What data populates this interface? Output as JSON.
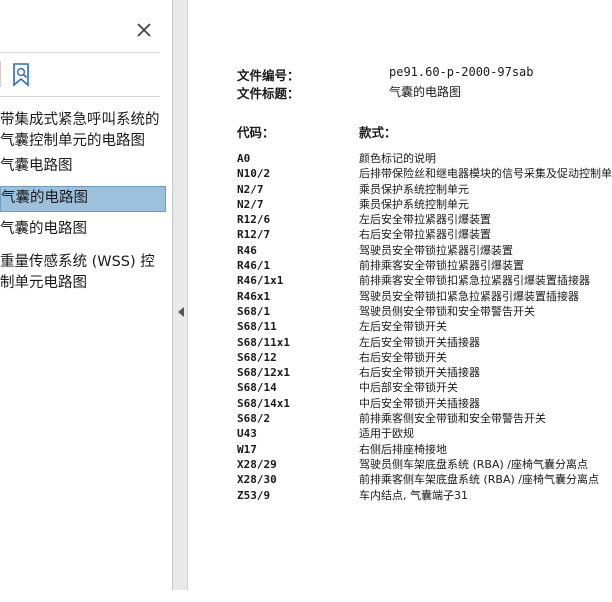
{
  "sidebar": {
    "close_label": "×",
    "items": [
      {
        "lines": [
          "带集成式紧急呼叫系统的",
          "气囊控制单元的电路图"
        ]
      },
      {
        "lines": [
          "气囊电路图"
        ]
      },
      {
        "lines": [
          "气囊的电路图"
        ],
        "selected": true
      },
      {
        "lines": [
          "气囊的电路图"
        ]
      },
      {
        "lines": [
          "重量传感系统 (WSS) 控",
          "制单元电路图"
        ]
      }
    ]
  },
  "document": {
    "doc_number_label": "文件编号：",
    "doc_number": "pe91.60-p-2000-97sab",
    "doc_title_label": "文件标题：",
    "doc_title": "气囊的电路图",
    "code_header": "代码：",
    "model_header": "款式：",
    "parts": [
      {
        "code": "A0",
        "desc": "颜色标记的说明"
      },
      {
        "code": "N10/2",
        "desc": "后排带保险丝和继电器模块的信号采集及促动控制单元"
      },
      {
        "code": "N2/7",
        "desc": "乘员保护系统控制单元"
      },
      {
        "code": "N2/7",
        "desc": "乘员保护系统控制单元"
      },
      {
        "code": "R12/6",
        "desc": "左后安全带拉紧器引爆装置"
      },
      {
        "code": "R12/7",
        "desc": "右后安全带拉紧器引爆装置"
      },
      {
        "code": "R46",
        "desc": "驾驶员安全带锁拉紧器引爆装置"
      },
      {
        "code": "R46/1",
        "desc": "前排乘客安全带锁拉紧器引爆装置"
      },
      {
        "code": "R46/1x1",
        "desc": "前排乘客安全带锁扣紧急拉紧器引爆装置插接器"
      },
      {
        "code": "R46x1",
        "desc": "驾驶员安全带锁扣紧急拉紧器引爆装置插接器"
      },
      {
        "code": "S68/1",
        "desc": "驾驶员侧安全带锁和安全带警告开关"
      },
      {
        "code": "S68/11",
        "desc": "左后安全带锁开关"
      },
      {
        "code": "S68/11x1",
        "desc": "左后安全带锁开关插接器"
      },
      {
        "code": "S68/12",
        "desc": "右后安全带锁开关"
      },
      {
        "code": "S68/12x1",
        "desc": "右后安全带锁开关插接器"
      },
      {
        "code": "S68/14",
        "desc": "中后部安全带锁开关"
      },
      {
        "code": "S68/14x1",
        "desc": "中后安全带锁开关插接器"
      },
      {
        "code": "S68/2",
        "desc": "前排乘客侧安全带锁和安全带警告开关"
      },
      {
        "code": "U43",
        "desc": "适用于欧规"
      },
      {
        "code": "W17",
        "desc": "右侧后排座椅接地"
      },
      {
        "code": "X28/29",
        "desc": "驾驶员侧车架底盘系统 (RBA) /座椅气囊分离点"
      },
      {
        "code": "X28/30",
        "desc": "前排乘客侧车架底盘系统 (RBA) /座椅气囊分离点"
      },
      {
        "code": "Z53/9",
        "desc": "车内结点, 气囊端子31"
      }
    ]
  }
}
